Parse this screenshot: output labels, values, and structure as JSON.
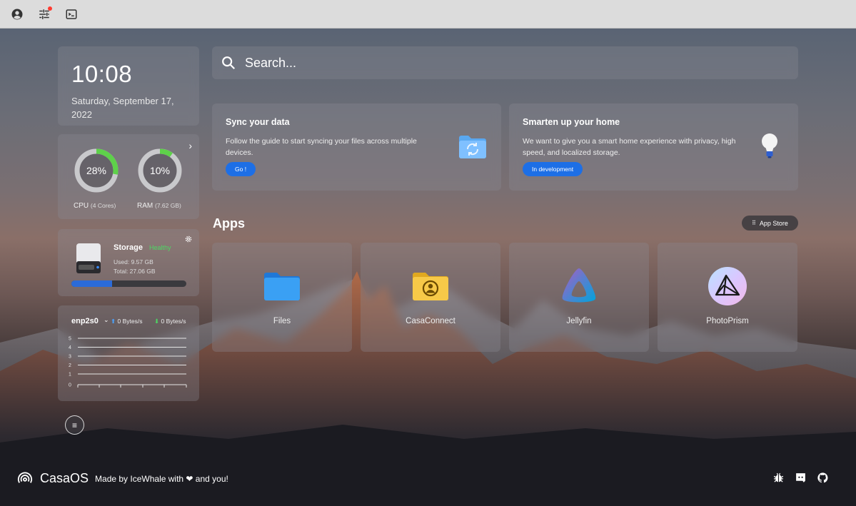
{
  "topbar": {
    "icons": [
      "account-icon",
      "settings-sliders-icon",
      "terminal-icon"
    ],
    "notification_color": "#ff3b30"
  },
  "clock": {
    "time": "10:08",
    "date": "Saturday, September 17, 2022"
  },
  "system": {
    "cpu": {
      "percent": 28,
      "value": "28%",
      "label": "CPU",
      "detail": "(4 Cores)"
    },
    "ram": {
      "percent": 10,
      "value": "10%",
      "label": "RAM",
      "detail": "(7.62 GB)"
    },
    "ring_color": "#5ed14a"
  },
  "storage": {
    "title": "Storage",
    "status": "Healthy",
    "used": "Used: 9.57 GB",
    "total": "Total: 27.06 GB",
    "used_fraction": 0.354
  },
  "network": {
    "interface": "enp2s0",
    "upload": "0 Bytes/s",
    "download": "0 Bytes/s",
    "y_ticks": [
      "5",
      "4",
      "3",
      "2",
      "1",
      "0"
    ]
  },
  "search": {
    "placeholder": "Search..."
  },
  "promos": [
    {
      "title": "Sync your data",
      "text": "Follow the guide to start syncing your files across multiple devices.",
      "button": "Go !"
    },
    {
      "title": "Smarten up your home",
      "text": "We want to give you a smart home experience with privacy, high speed, and localized storage.",
      "button": "In development"
    }
  ],
  "apps": {
    "title": "Apps",
    "store_button": "App Store",
    "items": [
      {
        "label": "Files"
      },
      {
        "label": "CasaConnect"
      },
      {
        "label": "Jellyfin"
      },
      {
        "label": "PhotoPrism"
      }
    ]
  },
  "footer": {
    "brand": "CasaOS",
    "credit": "Made by IceWhale with ❤ and you!",
    "icons": [
      "bug-icon",
      "discord-icon",
      "github-icon"
    ]
  }
}
